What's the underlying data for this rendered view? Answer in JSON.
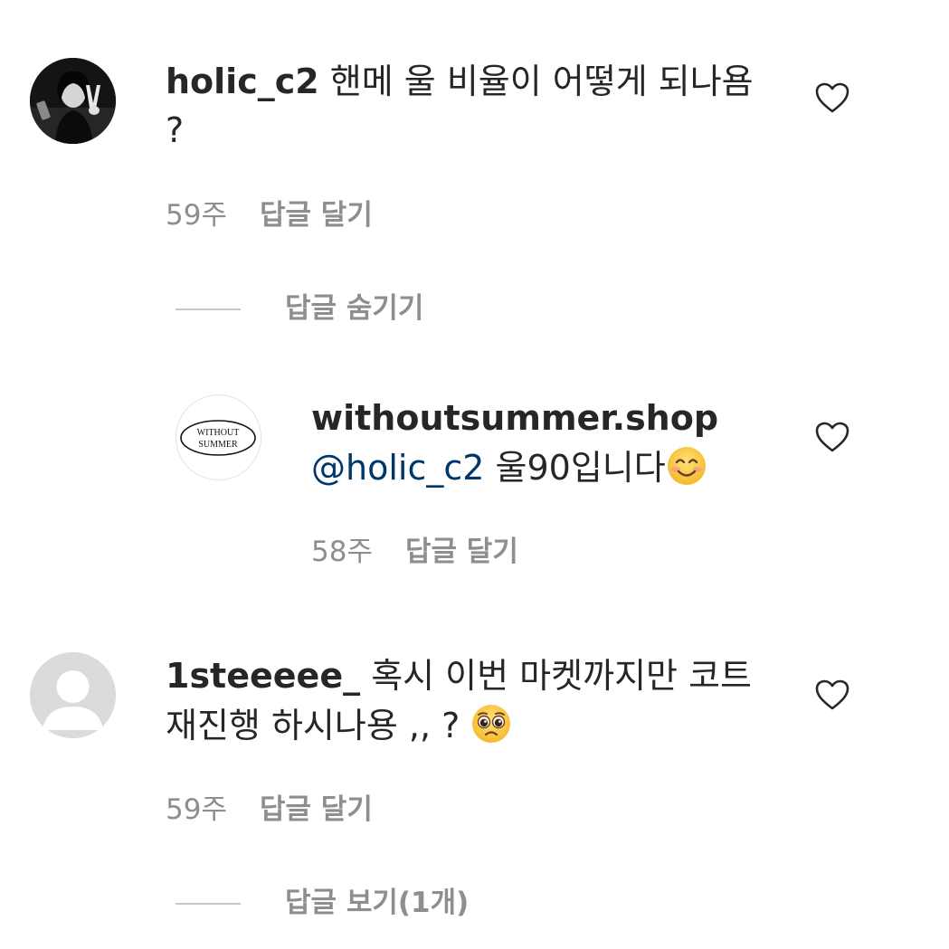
{
  "comments": [
    {
      "username": "holic_c2",
      "text_line1": "핸메 울 비율이 어떻게 되나욤",
      "text_line2": "?",
      "time": "59주",
      "reply_label": "답글 달기",
      "avatar": "profile-photo-peace-sign",
      "like_icon": "heart-outline-icon"
    },
    {
      "username": "withoutsummer.shop",
      "mention": "@holic_c2",
      "text": "울90입니다",
      "emoji": "smiling-face-with-smiling-eyes",
      "time": "58주",
      "reply_label": "답글 달기",
      "avatar_logo_line1": "WITHOUT",
      "avatar_logo_line2": "SUMMER",
      "like_icon": "heart-outline-icon"
    },
    {
      "username": "1steeeee_",
      "text_line1": "혹시 이번 마켓까지만 코트",
      "text_line2": "재진행 하시나용 ,, ?",
      "emoji": "pleading-face",
      "time": "59주",
      "reply_label": "답글 달기",
      "avatar": "default-profile-placeholder",
      "like_icon": "heart-outline-icon"
    }
  ],
  "threads": {
    "hide_replies": "답글 숨기기",
    "view_replies": "답글 보기(1개)"
  },
  "colors": {
    "text": "#262626",
    "secondary": "#8e8e8e",
    "mention": "#00376b",
    "divider": "#c7c7c7"
  }
}
